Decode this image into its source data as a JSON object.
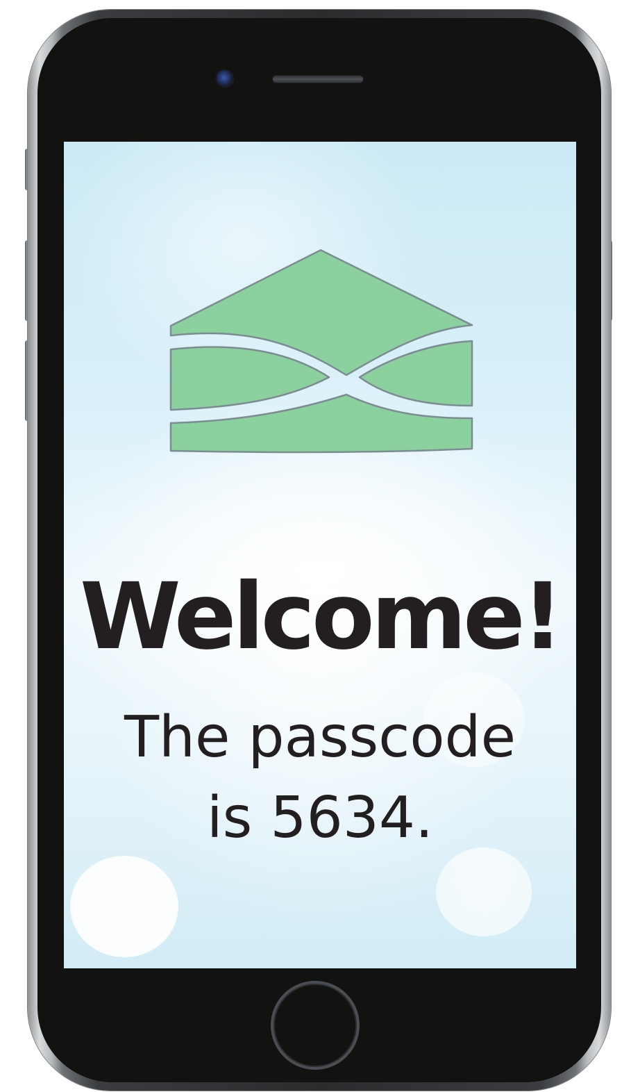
{
  "device": {
    "type": "smartphone",
    "icons": {
      "camera": "front-camera-icon",
      "speaker": "earpiece-speaker-icon",
      "home": "home-button-icon"
    },
    "colors": {
      "frame": "#2a2c2e",
      "body": "#121311"
    }
  },
  "screen": {
    "logo": {
      "icon": "house-logo-icon",
      "fill_color": "#8bd19e",
      "stroke_color": "#7d8c92"
    },
    "welcome_text": "Welcome!",
    "message_text": "The passcode is 5634.",
    "text_color": "#231f20",
    "background_color": "#d9f0f9"
  }
}
